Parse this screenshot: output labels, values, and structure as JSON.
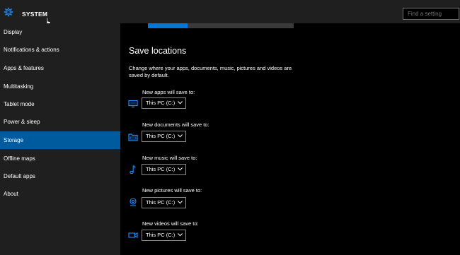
{
  "header": {
    "title": "SYSTEM",
    "search_placeholder": "Find a setting"
  },
  "sidebar": {
    "items": [
      {
        "label": "Display",
        "selected": false
      },
      {
        "label": "Notifications & actions",
        "selected": false
      },
      {
        "label": "Apps & features",
        "selected": false
      },
      {
        "label": "Multitasking",
        "selected": false
      },
      {
        "label": "Tablet mode",
        "selected": false
      },
      {
        "label": "Power & sleep",
        "selected": false
      },
      {
        "label": "Storage",
        "selected": true
      },
      {
        "label": "Offline maps",
        "selected": false
      },
      {
        "label": "Default apps",
        "selected": false
      },
      {
        "label": "About",
        "selected": false
      }
    ]
  },
  "storage": {
    "usage_fraction": 0.27
  },
  "save_locations": {
    "title": "Save locations",
    "description": "Change where your apps, documents, music, pictures and videos are saved by default.",
    "rows": [
      {
        "label": "New apps will save to:",
        "value": "This PC (C:)",
        "icon": "monitor-icon"
      },
      {
        "label": "New documents will save to:",
        "value": "This PC (C:)",
        "icon": "document-drive-icon"
      },
      {
        "label": "New music will save to:",
        "value": "This PC (C:)",
        "icon": "music-note-icon"
      },
      {
        "label": "New pictures will save to:",
        "value": "This PC (C:)",
        "icon": "camera-icon"
      },
      {
        "label": "New videos will save to:",
        "value": "This PC (C:)",
        "icon": "video-camera-icon"
      }
    ]
  },
  "colors": {
    "accent": "#0078d7",
    "selected_nav": "#005a9e",
    "sidebar_bg": "#1f1f1f",
    "content_bg": "#000000"
  }
}
